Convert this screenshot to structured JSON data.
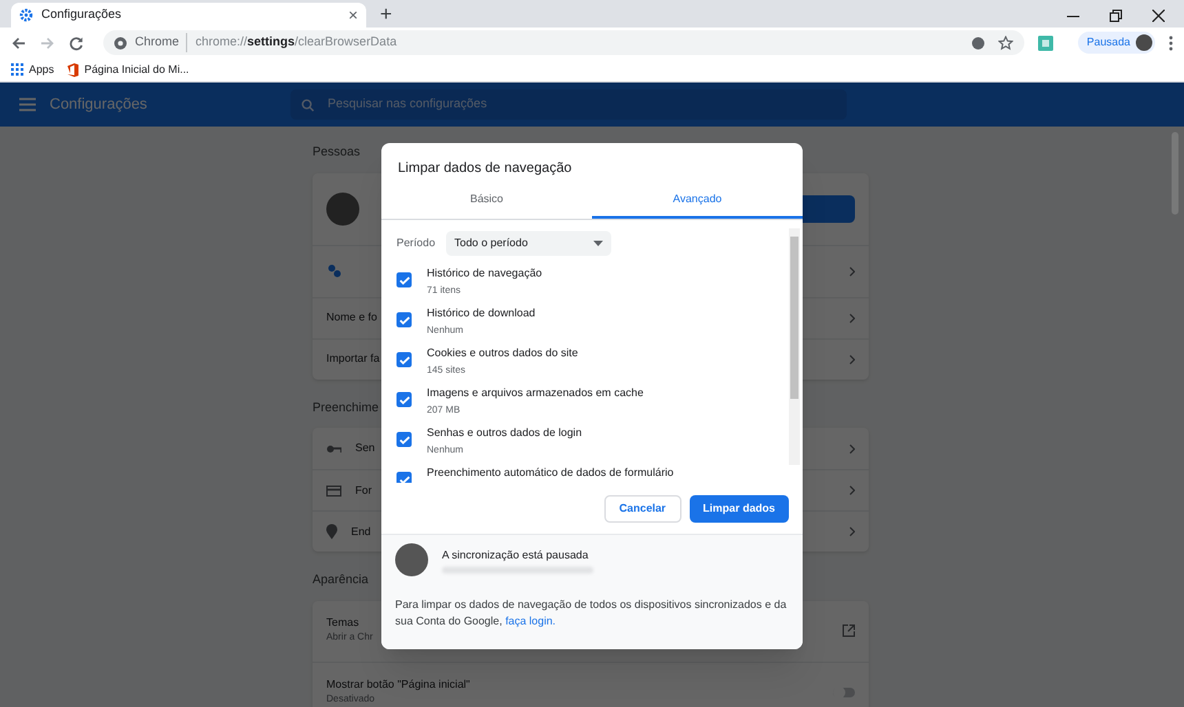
{
  "browser": {
    "tab": {
      "title": "Configurações",
      "close": "×"
    },
    "new_tab": "+",
    "omnibox": {
      "scheme_label": "Chrome",
      "url": "chrome://**settings**/clearBrowserData"
    },
    "profile_button": "Pausada",
    "bookmarks": [
      "Apps",
      "Página Inicial do Mi..."
    ]
  },
  "settings_header": {
    "title": "Configurações",
    "search_placeholder": "Pesquisar nas configurações"
  },
  "sections": [
    {
      "title": "Pessoas",
      "rows": [
        {
          "kind": "avatar"
        },
        {
          "kind": "google"
        },
        {
          "kind": "arrow",
          "label": "Nome e fo"
        },
        {
          "kind": "arrow",
          "label": "Importar fa"
        }
      ]
    },
    {
      "title": "Preenchime",
      "rows": [
        {
          "kind": "key",
          "label": "Sen"
        },
        {
          "kind": "card",
          "label": "For"
        },
        {
          "kind": "pin",
          "label": "End"
        }
      ]
    },
    {
      "title": "Aparência",
      "rows": [
        {
          "kind": "external",
          "label": "Temas",
          "sublabel": "Abrir a Chr"
        },
        {
          "kind": "toggle",
          "label": "Mostrar botão \"Página inicial\"",
          "sublabel": "Desativado",
          "on": false
        }
      ]
    }
  ],
  "dialog": {
    "title": "Limpar dados de navegação",
    "tabs": [
      {
        "label": "Básico",
        "selected": false
      },
      {
        "label": "Avançado",
        "selected": true
      }
    ],
    "period": {
      "label": "Período",
      "value": "Todo o período"
    },
    "items": [
      {
        "label": "Histórico de navegação",
        "detail": "71 itens",
        "checked": true
      },
      {
        "label": "Histórico de download",
        "detail": "Nenhum",
        "checked": true
      },
      {
        "label": "Cookies e outros dados do site",
        "detail": "145 sites",
        "checked": true
      },
      {
        "label": "Imagens e arquivos armazenados em cache",
        "detail": "207 MB",
        "checked": true
      },
      {
        "label": "Senhas e outros dados de login",
        "detail": "Nenhum",
        "checked": true
      },
      {
        "label": "Preenchimento automático de dados de formulário",
        "checked": true
      }
    ],
    "buttons": [
      {
        "label": "Cancelar",
        "kind": "secondary"
      },
      {
        "label": "Limpar dados",
        "kind": "primary"
      }
    ],
    "sync_status": "A sincronização está pausada",
    "footer": {
      "text": "Para limpar os dados de navegação de todos os dispositivos sincronizados e da sua Conta do Google,",
      "link": "faça login."
    }
  }
}
